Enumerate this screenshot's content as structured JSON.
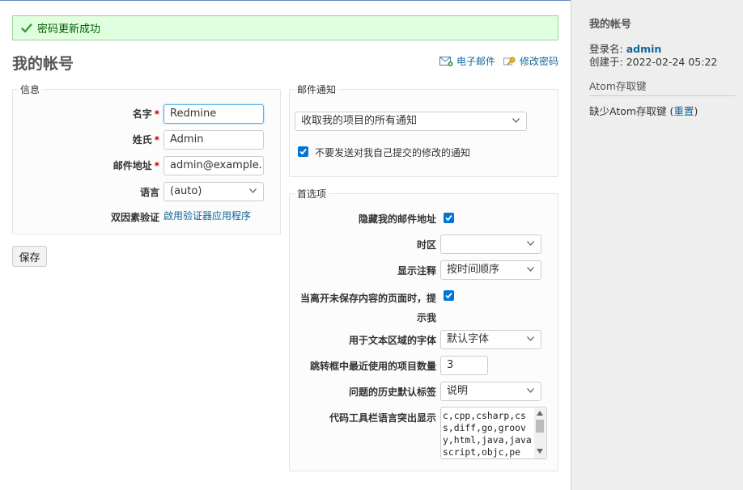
{
  "flash": {
    "text": "密码更新成功"
  },
  "page": {
    "title": "我的帐号"
  },
  "contextual": {
    "email_label": "电子邮件",
    "password_label": "修改密码"
  },
  "info": {
    "legend": "信息",
    "firstname": {
      "label": "名字",
      "value": "Redmine"
    },
    "lastname": {
      "label": "姓氏",
      "value": "Admin"
    },
    "mail": {
      "label": "邮件地址",
      "value": "admin@example.r"
    },
    "language": {
      "label": "语言",
      "value": "(auto)"
    },
    "twofa": {
      "label": "双因素验证",
      "link": "啟用验证器应用程序"
    }
  },
  "save_button": "保存",
  "mail_notification": {
    "legend": "邮件通知",
    "selected": "收取我的项目的所有通知",
    "no_self_notified": {
      "label": "不要发送对我自己提交的修改的通知",
      "checked": true
    }
  },
  "preferences": {
    "legend": "首选项",
    "hide_mail": {
      "label": "隐藏我的邮件地址",
      "checked": true
    },
    "time_zone": {
      "label": "时区",
      "value": ""
    },
    "comments_sorting": {
      "label": "显示注释",
      "value": "按时间顺序"
    },
    "warn_unsaved": {
      "label_line1": "当离开未保存内容的页面时，提",
      "label_line2": "示我",
      "checked": true
    },
    "textarea_font": {
      "label": "用于文本区域的字体",
      "value": "默认字体"
    },
    "recently_used_projects": {
      "label": "跳转框中最近使用的项目数量",
      "value": "3"
    },
    "history_default_tab": {
      "label": "问题的历史默认标签",
      "value": "说明"
    },
    "toolbar_languages": {
      "label": "代码工具栏语言突出显示",
      "value": "c,cpp,csharp,css,diff,go,groovy,html,java,javascript,objc,pe"
    }
  },
  "sidebar": {
    "title": "我的帐号",
    "login_label": "登录名:",
    "login_value": "admin",
    "created_label": "创建于:",
    "created_value": "2022-02-24 05:22",
    "atom_title": "Atom存取键",
    "atom_missing": "缺少Atom存取键",
    "atom_reset_open": "(",
    "atom_reset": "重置",
    "atom_reset_close": ")"
  },
  "colors": {
    "link": "#116699",
    "flash_bg": "#dfffdf",
    "checkbox": "#0075d6",
    "required": "#bb0000"
  }
}
